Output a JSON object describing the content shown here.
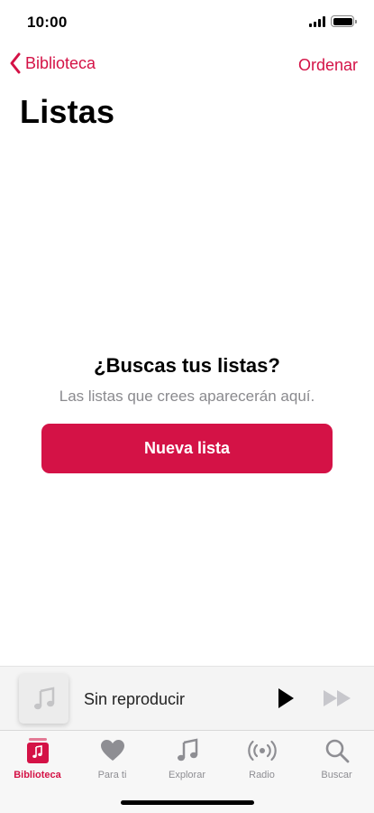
{
  "status_bar": {
    "time": "10:00"
  },
  "nav": {
    "back_label": "Biblioteca",
    "sort_label": "Ordenar"
  },
  "page": {
    "title": "Listas"
  },
  "empty_state": {
    "title": "¿Buscas tus listas?",
    "subtitle": "Las listas que crees aparecerán aquí.",
    "button_label": "Nueva lista"
  },
  "mini_player": {
    "now_playing": "Sin reproducir"
  },
  "tabs": [
    {
      "label": "Biblioteca",
      "icon": "library-icon",
      "active": true
    },
    {
      "label": "Para ti",
      "icon": "heart-icon",
      "active": false
    },
    {
      "label": "Explorar",
      "icon": "music-note-icon",
      "active": false
    },
    {
      "label": "Radio",
      "icon": "radio-icon",
      "active": false
    },
    {
      "label": "Buscar",
      "icon": "search-icon",
      "active": false
    }
  ],
  "colors": {
    "accent": "#d41246",
    "inactive": "#8e8e93",
    "background": "#ffffff"
  }
}
